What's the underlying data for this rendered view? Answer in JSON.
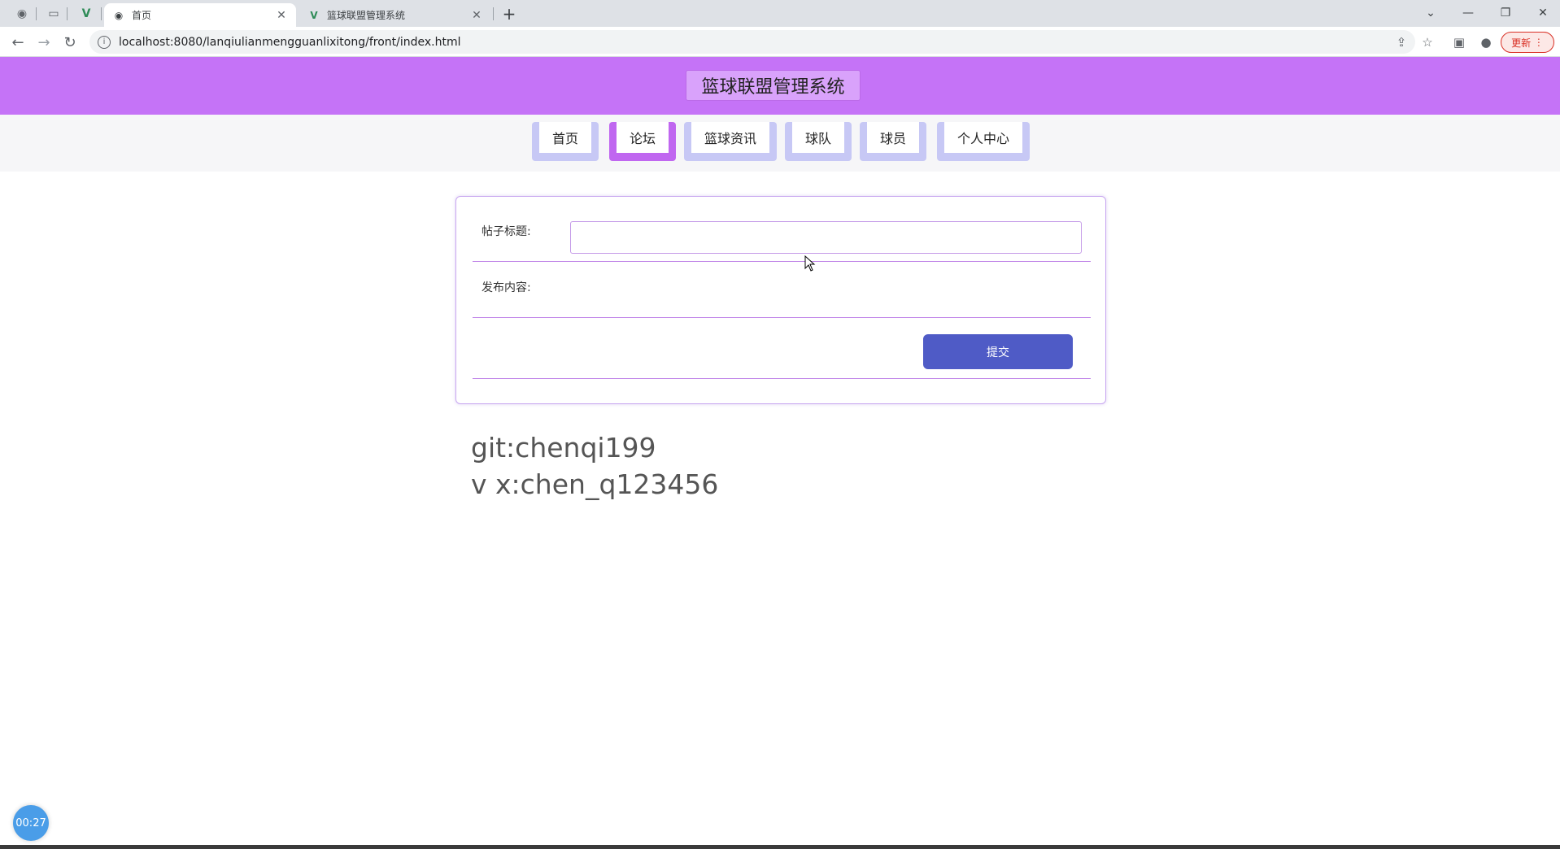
{
  "browser": {
    "tabs": [
      {
        "title": "首页",
        "active": true
      },
      {
        "title": "篮球联盟管理系统",
        "active": false
      }
    ],
    "url": "localhost:8080/lanqiulianmengguanlixitong/front/index.html",
    "update_label": "更新"
  },
  "site": {
    "title": "篮球联盟管理系统"
  },
  "nav": {
    "items": [
      {
        "label": "首页",
        "active": false
      },
      {
        "label": "论坛",
        "active": true
      },
      {
        "label": "篮球资讯",
        "active": false
      },
      {
        "label": "球队",
        "active": false
      },
      {
        "label": "球员",
        "active": false
      },
      {
        "label": "个人中心",
        "active": false
      }
    ]
  },
  "form": {
    "title_label": "帖子标题:",
    "title_value": "",
    "content_label": "发布内容:",
    "submit_label": "提交"
  },
  "credit": {
    "line1": "git:chenqi199",
    "line2": "v x:chen_q123456"
  },
  "timer": "00:27",
  "colors": {
    "header": "#c573f7",
    "nav_button": "#c7c8f5",
    "nav_active": "#c067f0",
    "submit": "#4f5bc6"
  }
}
